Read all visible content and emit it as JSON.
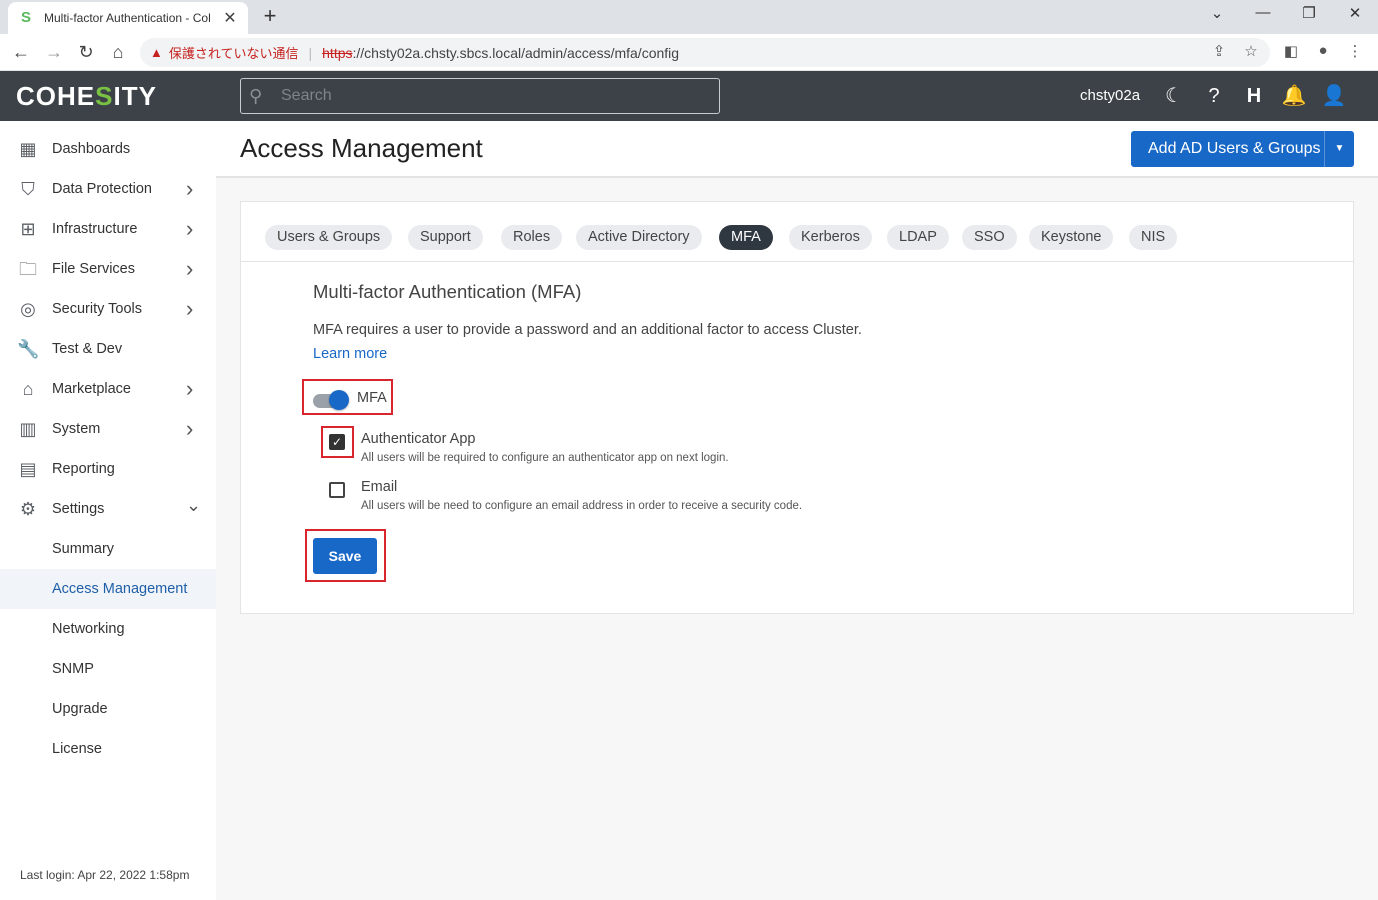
{
  "browser": {
    "tab_title": "Multi-factor Authentication - Col",
    "security_warning": "保護されていない通信",
    "url_scheme": "https",
    "url_rest": "://chsty02a.chsty.sbcs.local/admin/access/mfa/config"
  },
  "header": {
    "logo_prefix": "COHE",
    "logo_accent": "S",
    "logo_suffix": "ITY",
    "search_placeholder": "Search",
    "cluster_name": "chsty02a"
  },
  "sidebar": {
    "items": [
      {
        "label": "Dashboards",
        "icon": "dashboard-icon",
        "glyph": "▦",
        "has_chevron": false
      },
      {
        "label": "Data Protection",
        "icon": "shield-icon",
        "glyph": "⛉",
        "has_chevron": true
      },
      {
        "label": "Infrastructure",
        "icon": "infrastructure-icon",
        "glyph": "⊞",
        "has_chevron": true
      },
      {
        "label": "File Services",
        "icon": "folder-icon",
        "glyph": "🗀",
        "has_chevron": true
      },
      {
        "label": "Security Tools",
        "icon": "fingerprint-icon",
        "glyph": "◎",
        "has_chevron": true
      },
      {
        "label": "Test & Dev",
        "icon": "wrench-icon",
        "glyph": "🔧",
        "has_chevron": false
      },
      {
        "label": "Marketplace",
        "icon": "store-icon",
        "glyph": "⌂",
        "has_chevron": true
      },
      {
        "label": "System",
        "icon": "system-icon",
        "glyph": "▥",
        "has_chevron": true
      },
      {
        "label": "Reporting",
        "icon": "reporting-icon",
        "glyph": "▤",
        "has_chevron": false
      },
      {
        "label": "Settings",
        "icon": "gear-icon",
        "glyph": "⚙",
        "has_chevron": true
      }
    ],
    "settings_children": [
      "Summary",
      "Access Management",
      "Networking",
      "SNMP",
      "Upgrade",
      "License"
    ],
    "active_child": "Access Management",
    "last_login": "Last login: Apr 22, 2022 1:58pm"
  },
  "main": {
    "page_title": "Access Management",
    "add_button": "Add AD Users & Groups",
    "tabs": [
      "Users & Groups",
      "Support",
      "Roles",
      "Active Directory",
      "MFA",
      "Kerberos",
      "LDAP",
      "SSO",
      "Keystone",
      "NIS"
    ],
    "active_tab": "MFA",
    "section_title": "Multi-factor Authentication (MFA)",
    "description": "MFA requires a user to provide a password and an additional factor to access Cluster.",
    "learn_more": "Learn more",
    "mfa_toggle_label": "MFA",
    "mfa_enabled": true,
    "options": [
      {
        "title": "Authenticator App",
        "subtitle": "All users will be required to configure an authenticator app on next login.",
        "checked": true
      },
      {
        "title": "Email",
        "subtitle": "All users will be need to configure an email address in order to receive a security code.",
        "checked": false
      }
    ],
    "save_label": "Save"
  },
  "colors": {
    "primary": "#1868c7",
    "header_bg": "#3c4247",
    "highlight": "#d9262c",
    "brand_accent": "#7ac143"
  }
}
